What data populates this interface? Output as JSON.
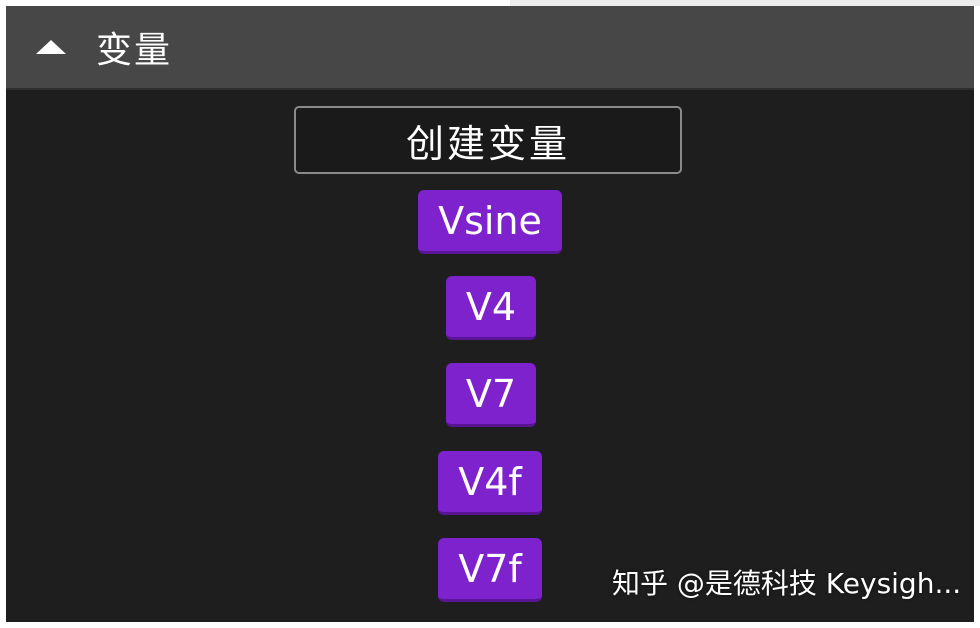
{
  "panel": {
    "title": "变量",
    "collapse_icon": "triangle-up-icon",
    "create_button_label": "创建变量"
  },
  "variables": [
    {
      "label": "Vsine"
    },
    {
      "label": "V4"
    },
    {
      "label": "V7"
    },
    {
      "label": "V4f"
    },
    {
      "label": "V7f"
    }
  ],
  "watermark": {
    "text": "知乎 @是德科技 Keysigh..."
  },
  "colors": {
    "header_bg": "#474747",
    "panel_bg": "#1e1e1e",
    "variable_block": "#7e22ce",
    "text": "#ffffff"
  }
}
